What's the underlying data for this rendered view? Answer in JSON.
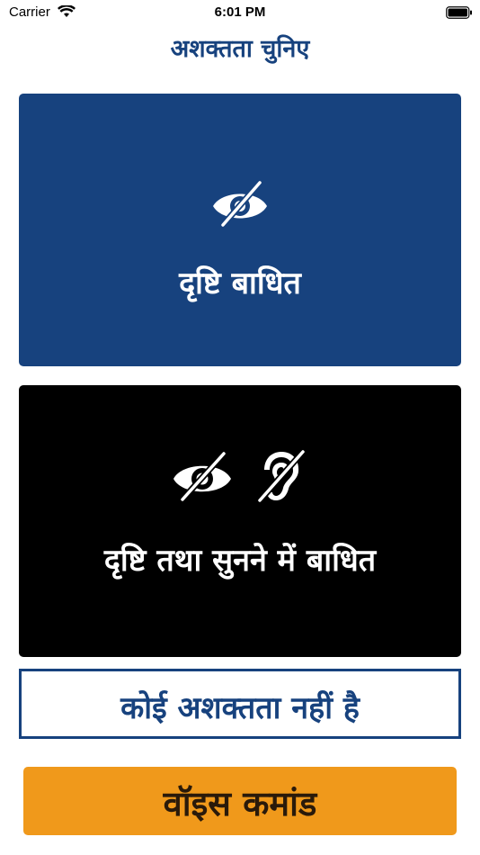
{
  "status_bar": {
    "carrier": "Carrier",
    "time": "6:01 PM"
  },
  "header": {
    "title": "अशक्तता चुनिए"
  },
  "options": {
    "visual": {
      "label": "दृष्टि बाधित",
      "icon": "eye-slash-icon"
    },
    "visual_hearing": {
      "label": "दृष्टि तथा सुनने में बाधित",
      "icons": [
        "eye-slash-icon",
        "ear-slash-icon"
      ]
    },
    "none": {
      "label": "कोई अशक्तता नहीं है"
    }
  },
  "voice_command": {
    "label": "वॉइस कमांड"
  },
  "colors": {
    "primary_blue": "#17427e",
    "black": "#000000",
    "orange": "#f0991b"
  }
}
